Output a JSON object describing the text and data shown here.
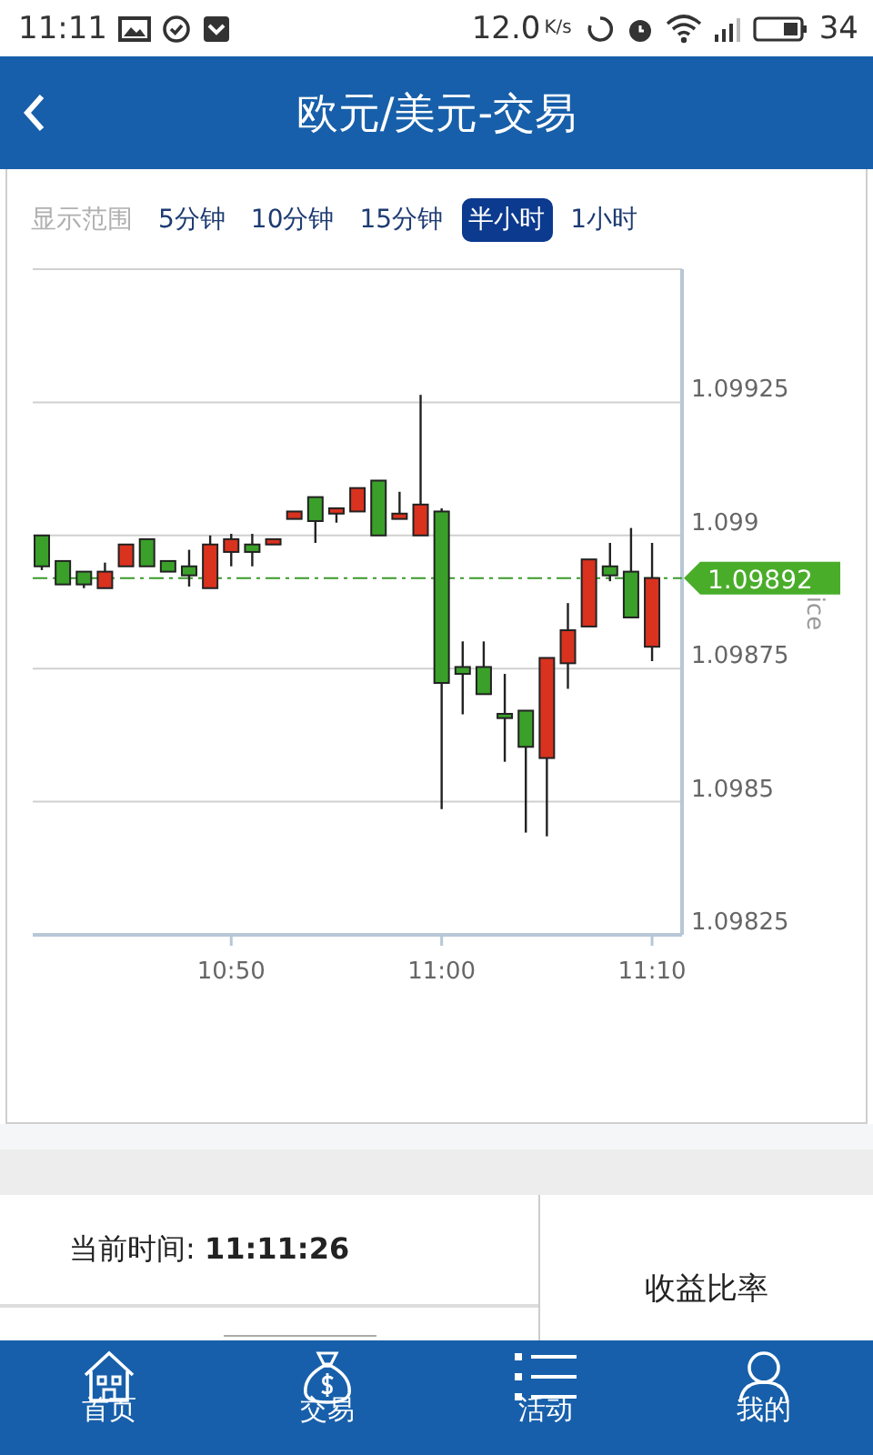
{
  "status_bar": {
    "time": "11:11",
    "speed": "12.0",
    "speed_unit": "K/s",
    "battery": "34"
  },
  "header": {
    "title": "欧元/美元-交易"
  },
  "range": {
    "label": "显示范围",
    "options": [
      {
        "label": "5分钟",
        "selected": false
      },
      {
        "label": "10分钟",
        "selected": false
      },
      {
        "label": "15分钟",
        "selected": false
      },
      {
        "label": "半小时",
        "selected": true
      },
      {
        "label": "1小时",
        "selected": false
      }
    ]
  },
  "chart_data": {
    "type": "candlestick",
    "ylabel": "ice",
    "categories": [
      null,
      null,
      null,
      null,
      null,
      null,
      null,
      null,
      null,
      "10:50",
      null,
      null,
      null,
      null,
      null,
      null,
      null,
      null,
      null,
      "11:00",
      null,
      null,
      null,
      null,
      null,
      null,
      null,
      null,
      null,
      "11:10"
    ],
    "ohlc": [
      [
        1.099,
        1.099,
        1.098935,
        1.098942
      ],
      [
        1.098952,
        1.098952,
        1.098908,
        1.098908
      ],
      [
        1.098932,
        1.098932,
        1.098901,
        1.098908
      ],
      [
        1.098901,
        1.098949,
        1.098901,
        1.098932
      ],
      [
        1.098942,
        1.098983,
        1.098942,
        1.098983
      ],
      [
        1.098993,
        1.098993,
        1.098942,
        1.098942
      ],
      [
        1.098952,
        1.098952,
        1.098932,
        1.098932
      ],
      [
        1.098942,
        1.098973,
        1.098904,
        1.098925
      ],
      [
        1.098901,
        1.099,
        1.098901,
        1.098983
      ],
      [
        1.098969,
        1.099003,
        1.098942,
        1.098993
      ],
      [
        1.098983,
        1.099003,
        1.098942,
        1.098969
      ],
      [
        1.098983,
        1.098993,
        1.098983,
        1.098993
      ],
      [
        1.099031,
        1.099045,
        1.099031,
        1.099045
      ],
      [
        1.099072,
        1.099072,
        1.098986,
        1.099027
      ],
      [
        1.099041,
        1.099051,
        1.099024,
        1.099051
      ],
      [
        1.099045,
        1.099089,
        1.099045,
        1.099089
      ],
      [
        1.099103,
        1.099103,
        1.099,
        1.099
      ],
      [
        1.099031,
        1.099082,
        1.099031,
        1.099041
      ],
      [
        1.099,
        1.099264,
        1.099,
        1.099058
      ],
      [
        1.099045,
        1.099051,
        1.098486,
        1.098723
      ],
      [
        1.098753,
        1.098801,
        1.098664,
        1.09874
      ],
      [
        1.098753,
        1.098801,
        1.098702,
        1.098702
      ],
      [
        1.098665,
        1.09874,
        1.098575,
        1.098657
      ],
      [
        1.098671,
        1.098671,
        1.098442,
        1.098603
      ],
      [
        1.098582,
        1.09877,
        1.098435,
        1.09877
      ],
      [
        1.09876,
        1.098873,
        1.098712,
        1.098822
      ],
      [
        1.098829,
        1.098955,
        1.098829,
        1.098955
      ],
      [
        1.098942,
        1.098986,
        1.098914,
        1.098925
      ],
      [
        1.098932,
        1.099014,
        1.098846,
        1.098846
      ],
      [
        1.098791,
        1.098986,
        1.098764,
        1.09892
      ]
    ],
    "ylim": [
      1.09825,
      1.0995
    ],
    "yticks": [
      1.09825,
      1.0985,
      1.09875,
      1.099,
      1.09925
    ],
    "grid": true,
    "ref_lines": [
      {
        "axis": "y",
        "value": 1.09892,
        "label": "1.09892"
      }
    ]
  },
  "info": {
    "time_label": "当前时间: **11:11:26**",
    "ratio_label": "收益比率"
  },
  "nav": [
    {
      "label": "首页",
      "kind": "home"
    },
    {
      "label": "交易",
      "kind": "trade"
    },
    {
      "label": "活动",
      "kind": "list"
    },
    {
      "label": "我的",
      "kind": "profile"
    }
  ]
}
